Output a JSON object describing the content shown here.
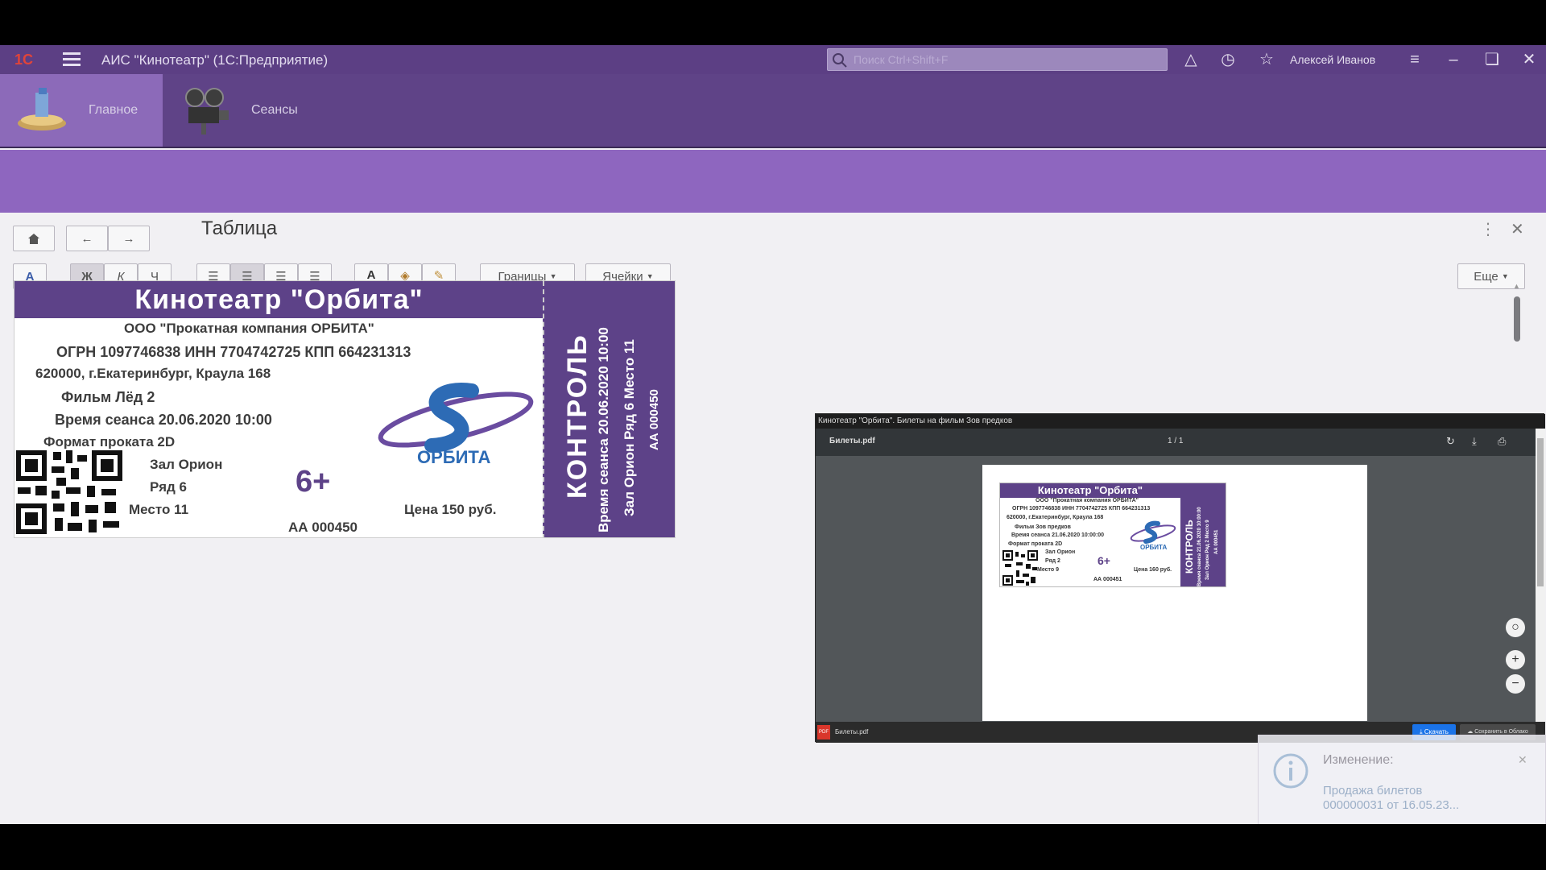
{
  "titlebar": {
    "app_title": "АИС \"Кинотеатр\" (1С:Предприятие)",
    "search_placeholder": "Поиск Ctrl+Shift+F",
    "user": "Алексей Иванов"
  },
  "sections": [
    {
      "label": "Главное",
      "active": true,
      "icon": "home-section-icon"
    },
    {
      "label": "Сеансы",
      "active": false,
      "icon": "film-camera-icon"
    }
  ],
  "form": {
    "title": "Таблица",
    "toolbar": {
      "bold": "Ж",
      "italic": "К",
      "underline": "Ч",
      "font_button": "A",
      "borders": "Границы",
      "cells": "Ячейки",
      "more": "Еще"
    }
  },
  "ticket": {
    "header": "Кинотеатр \"Орбита\"",
    "company": "ООО \"Прокатная компания ОРБИТА\"",
    "ids": "ОГРН 1097746838  ИНН 7704742725  КПП 664231313",
    "address": "620000, г.Екатеринбург, Краула 168",
    "film": "Фильм  Лёд 2",
    "session": "Время сеанса  20.06.2020 10:00",
    "format": "Формат проката  2D",
    "hall": "Зал  Орион",
    "row": "Ряд  6",
    "seat": "Место  11",
    "age": "6+",
    "price": "Цена  150 руб.",
    "number": "АА 000450",
    "logo_text": "ОРБИТА",
    "stub_title": "КОНТРОЛЬ",
    "stub_line1": "Время сеанса 20.06.2020 10:00",
    "stub_line2": "Зал Орион Ряд 6 Место 11",
    "stub_line3": "АА 000450"
  },
  "viewer": {
    "window_title": "Кинотеатр \"Орбита\". Билеты на фильм Зов предков",
    "filename": "Билеты.pdf",
    "pages": "1 / 1",
    "download_button": "Скачать",
    "cloud_button": "Сохранить в Облако",
    "bottom_file": "Билеты.pdf",
    "ticket": {
      "header": "Кинотеатр \"Орбита\"",
      "company": "ООО \"Прокатная компания ОРБИТА\"",
      "ids": "ОГРН 1097746838  ИНН 7704742725  КПП 664231313",
      "address": "620000, г.Екатеринбург, Краула 168",
      "film": "Фильм  Зов предков",
      "session": "Время сеанса  21.06.2020 10:00:00",
      "format": "Формат проката  2D",
      "hall": "Зал  Орион",
      "row": "Ряд  2",
      "seat": "Место  9",
      "age": "6+",
      "price": "Цена  160 руб.",
      "number": "АА 000451",
      "logo_text": "ОРБИТА",
      "stub_title": "КОНТРОЛЬ",
      "stub_line1": "Время сеанса 21.06.2020 10:00:00",
      "stub_line2": "Зал Орион Ряд 2 Место 9",
      "stub_line3": "АА 000451"
    }
  },
  "notification": {
    "title": "Изменение:",
    "line1": "Продажа билетов",
    "line2": "000000031 от 16.05.23..."
  }
}
